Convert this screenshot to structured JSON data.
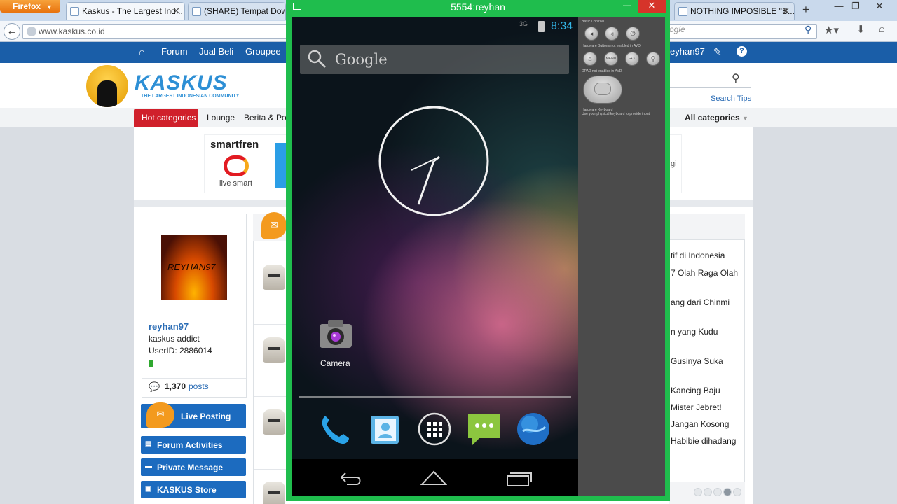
{
  "browser": {
    "menu_label": "Firefox",
    "tabs": [
      {
        "title": "Kaskus - The Largest Ind...",
        "active": true
      },
      {
        "title": "(SHARE) Tempat Downl"
      },
      {
        "title": "NOTHING IMPOSIBLE \"B..."
      }
    ],
    "url": "www.kaskus.co.id",
    "search_placeholder": "ogle"
  },
  "emulator": {
    "title": "5554:reyhan",
    "status": {
      "network": "3G",
      "time": "8:34"
    },
    "search_label": "Google",
    "home_icons": [
      {
        "label": "Camera",
        "icon": "camera-icon"
      }
    ],
    "dock": [
      "phone-icon",
      "contacts-icon",
      "app-drawer-icon",
      "messaging-icon",
      "browser-icon"
    ],
    "nav": [
      "back-icon",
      "home-icon",
      "recents-icon"
    ],
    "controls": {
      "basic_label": "Basic Controls",
      "hw_buttons_label": "Hardware Buttons not enabled in AVD",
      "menu_key": "MENU",
      "dpad_label": "DPAD not enabled in AVD",
      "keyboard_label": "Hardware Keyboard",
      "keyboard_note": "Use your physical keyboard to provide input"
    },
    "accent_color": "#33b5e5"
  },
  "kaskus": {
    "topnav": [
      "Forum",
      "Jual Beli",
      "Groupee"
    ],
    "user_nav_name": "eyhan97",
    "logo_text": "KASKUS",
    "logo_tagline": "THE LARGEST INDONESIAN COMMUNITY",
    "search_tips": "Search Tips",
    "hot_categories": "Hot categories",
    "categories": [
      "Lounge",
      "Berita & Pol"
    ],
    "all_categories": "All categories",
    "banner": {
      "brand": "smartfren",
      "tagline": "live smart",
      "right_text": "gi"
    },
    "profile": {
      "username": "reyhan97",
      "avatar_text": "REYHAN97",
      "rank": "kaskus addict",
      "user_id": "UserID: 2886014",
      "post_count": "1,370",
      "posts_label": "posts"
    },
    "sidebar_buttons": [
      {
        "label": "Live Posting"
      },
      {
        "label": "Forum Activities"
      },
      {
        "label": "Private Message"
      },
      {
        "label": "KASKUS Store"
      }
    ],
    "trending": [
      "tif di Indonesia",
      "7 Olah Raga Olah",
      "ang dari Chinmi",
      "n yang Kudu",
      "Gusinya Suka",
      "Kancing Baju",
      "Mister Jebret!",
      "Jangan Kosong",
      "Habibie dihadang"
    ],
    "brand_color": "#1a5ea8",
    "hot_color": "#d0202b"
  }
}
